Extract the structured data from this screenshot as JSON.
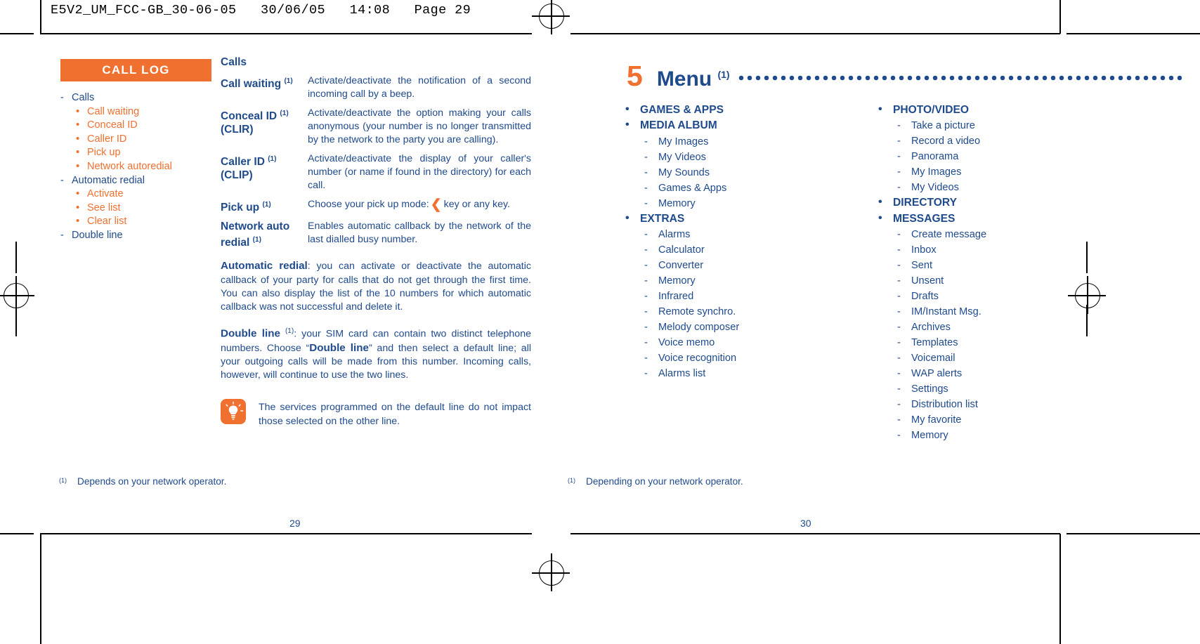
{
  "file_header": "E5V2_UM_FCC-GB_30-06-05   30/06/05   14:08   Page 29",
  "colors": {
    "accent_orange": "#f07030",
    "text_blue": "#1f4a8c"
  },
  "left_page": {
    "sidebar": {
      "banner": "CALL LOG",
      "items": [
        {
          "level": 1,
          "label": "Calls"
        },
        {
          "level": 2,
          "label": "Call waiting"
        },
        {
          "level": 2,
          "label": "Conceal ID"
        },
        {
          "level": 2,
          "label": "Caller ID"
        },
        {
          "level": 2,
          "label": "Pick up"
        },
        {
          "level": 2,
          "label": "Network autoredial"
        },
        {
          "level": 1,
          "label": "Automatic redial"
        },
        {
          "level": 2,
          "label": "Activate"
        },
        {
          "level": 2,
          "label": "See list"
        },
        {
          "level": 2,
          "label": "Clear list"
        },
        {
          "level": 1,
          "label": "Double line"
        }
      ]
    },
    "section_title": "Calls",
    "definitions": [
      {
        "term": "Call waiting",
        "term_note": "(1)",
        "term_line2": "",
        "desc": "Activate/deactivate the notification of a second incoming call by a beep."
      },
      {
        "term": "Conceal ID",
        "term_note": "(1)",
        "term_line2": "(CLIR)",
        "desc": "Activate/deactivate the option making your calls anonymous (your number is no longer transmitted by the network to the party you are calling)."
      },
      {
        "term": "Caller ID",
        "term_note": "(1)",
        "term_line2": "(CLIP)",
        "desc": "Activate/deactivate the display of your caller's number (or name if found in the directory) for each call."
      },
      {
        "term": "Pick up",
        "term_note": "(1)",
        "term_line2": "",
        "desc_before_key": "Choose your pick up mode:",
        "key_glyph": "phone-call-key",
        "desc_after_key": "key or any key."
      },
      {
        "term": "Network auto",
        "term_note": "",
        "term_line2": "redial",
        "term_line2_note": "(1)",
        "desc": "Enables automatic callback by the network of the last dialled busy number."
      }
    ],
    "paragraphs": [
      {
        "lead": "Automatic redial",
        "lead_note": "",
        "rest": ": you can activate or deactivate the automatic callback of your party for calls that do not get through the first time. You can also display the list of the 10 numbers for which automatic callback was not successful and delete it."
      },
      {
        "lead": "Double line",
        "lead_note": "(1)",
        "rest_a": ": your SIM card can contain two distinct telephone numbers. Choose “",
        "bold_mid": "Double line",
        "rest_b": "” and then select a default line; all your outgoing calls will be made from this number. Incoming calls, however, will continue to use the two lines."
      }
    ],
    "note": {
      "icon": "lightbulb-icon",
      "text": "The services programmed on the default line do not impact those selected on the other line."
    },
    "footnote": {
      "mark": "(1)",
      "text": "Depends on your network operator."
    },
    "folio": "29"
  },
  "right_page": {
    "chapter": {
      "number": "5",
      "title": "Menu",
      "note": "(1)"
    },
    "menu_column_1": [
      {
        "level": 1,
        "label": "GAMES & APPS"
      },
      {
        "level": 1,
        "label": "MEDIA ALBUM"
      },
      {
        "level": 2,
        "label": "My Images"
      },
      {
        "level": 2,
        "label": "My Videos"
      },
      {
        "level": 2,
        "label": "My Sounds"
      },
      {
        "level": 2,
        "label": "Games & Apps"
      },
      {
        "level": 2,
        "label": "Memory"
      },
      {
        "level": 1,
        "label": "EXTRAS"
      },
      {
        "level": 2,
        "label": "Alarms"
      },
      {
        "level": 2,
        "label": "Calculator"
      },
      {
        "level": 2,
        "label": "Converter"
      },
      {
        "level": 2,
        "label": "Memory"
      },
      {
        "level": 2,
        "label": "Infrared"
      },
      {
        "level": 2,
        "label": "Remote synchro."
      },
      {
        "level": 2,
        "label": "Melody composer"
      },
      {
        "level": 2,
        "label": "Voice memo"
      },
      {
        "level": 2,
        "label": "Voice recognition"
      },
      {
        "level": 2,
        "label": "Alarms list"
      }
    ],
    "menu_column_2": [
      {
        "level": 1,
        "label": "PHOTO/VIDEO"
      },
      {
        "level": 2,
        "label": "Take a picture"
      },
      {
        "level": 2,
        "label": "Record a video"
      },
      {
        "level": 2,
        "label": "Panorama"
      },
      {
        "level": 2,
        "label": "My Images"
      },
      {
        "level": 2,
        "label": "My Videos"
      },
      {
        "level": 1,
        "label": "DIRECTORY"
      },
      {
        "level": 1,
        "label": "MESSAGES"
      },
      {
        "level": 2,
        "label": "Create message"
      },
      {
        "level": 2,
        "label": "Inbox"
      },
      {
        "level": 2,
        "label": "Sent"
      },
      {
        "level": 2,
        "label": "Unsent"
      },
      {
        "level": 2,
        "label": "Drafts"
      },
      {
        "level": 2,
        "label": "IM/Instant Msg."
      },
      {
        "level": 2,
        "label": "Archives"
      },
      {
        "level": 2,
        "label": "Templates"
      },
      {
        "level": 2,
        "label": "Voicemail"
      },
      {
        "level": 2,
        "label": "WAP alerts"
      },
      {
        "level": 2,
        "label": "Settings"
      },
      {
        "level": 2,
        "label": "Distribution list"
      },
      {
        "level": 2,
        "label": "My favorite"
      },
      {
        "level": 2,
        "label": "Memory"
      }
    ],
    "footnote": {
      "mark": "(1)",
      "text": "Depending on your network operator."
    },
    "folio": "30"
  }
}
